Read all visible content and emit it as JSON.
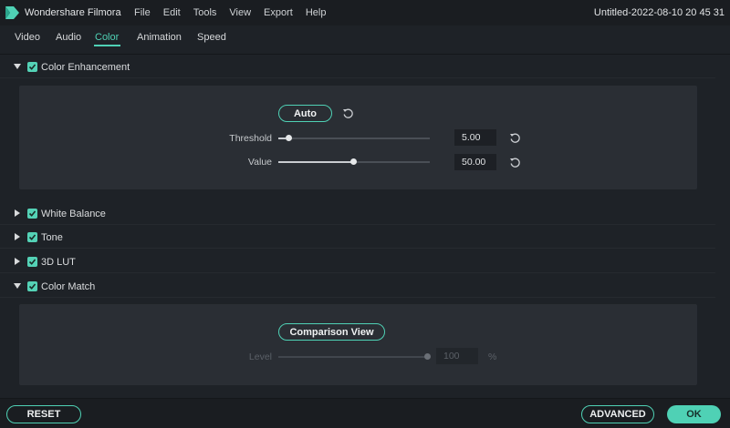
{
  "titlebar": {
    "app_name": "Wondershare Filmora",
    "menus": [
      "File",
      "Edit",
      "Tools",
      "View",
      "Export",
      "Help"
    ],
    "project_title": "Untitled-2022-08-10 20 45 31"
  },
  "tabs": [
    {
      "label": "Video"
    },
    {
      "label": "Audio"
    },
    {
      "label": "Color",
      "active": true
    },
    {
      "label": "Animation"
    },
    {
      "label": "Speed"
    }
  ],
  "sections": {
    "color_enhancement": {
      "label": "Color Enhancement",
      "expanded": true,
      "checked": true,
      "auto_label": "Auto",
      "threshold": {
        "label": "Threshold",
        "value": "5.00",
        "fraction": 0.05
      },
      "value": {
        "label": "Value",
        "value": "50.00",
        "fraction": 0.5
      }
    },
    "white_balance": {
      "label": "White Balance",
      "expanded": false,
      "checked": true
    },
    "tone": {
      "label": "Tone",
      "expanded": false,
      "checked": true
    },
    "lut": {
      "label": "3D LUT",
      "expanded": false,
      "checked": true
    },
    "color_match": {
      "label": "Color Match",
      "expanded": true,
      "checked": true,
      "comparison_label": "Comparison View",
      "level": {
        "label": "Level",
        "value": "100",
        "unit": "%",
        "fraction": 1.0,
        "disabled": true
      }
    }
  },
  "buttons": {
    "reset": "RESET",
    "advanced": "ADVANCED",
    "ok": "OK"
  },
  "colors": {
    "accent": "#4fd1b5",
    "background": "#1e2227",
    "panel": "#2a2e34"
  }
}
